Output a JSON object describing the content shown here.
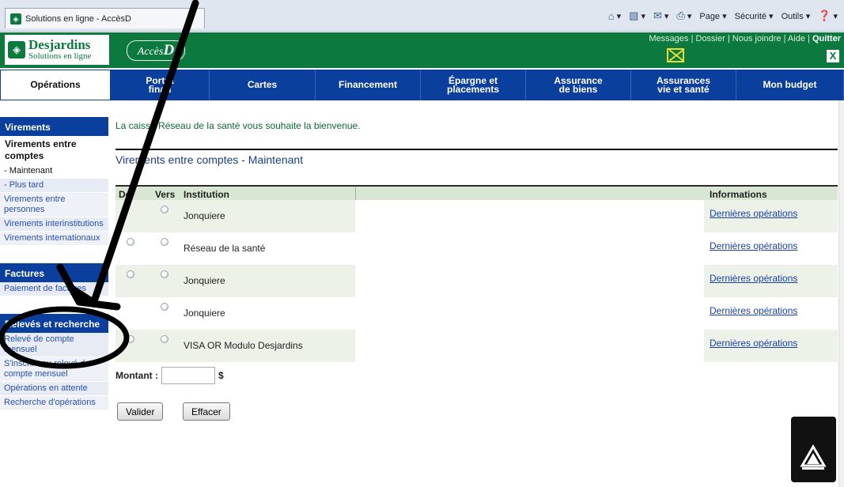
{
  "browser": {
    "tab_title": "Solutions en ligne - AccèsD",
    "commands": [
      "Page ▾",
      "Sécurité ▾",
      "Outils ▾"
    ]
  },
  "header": {
    "logo_line1": "Desjardins",
    "logo_line2": "Solutions en ligne",
    "accesd": "Accès",
    "accesd_d": "D",
    "links": [
      "Messages",
      "Dossier",
      "Nous joindre",
      "Aide",
      "Quitter"
    ]
  },
  "nav": {
    "items": [
      {
        "label": "Opérations",
        "active": true
      },
      {
        "label": "Portrait financier",
        "display": "Portra|finan"
      },
      {
        "label": "Cartes"
      },
      {
        "label": "Financement"
      },
      {
        "label": "Épargne et placements"
      },
      {
        "label": "Assurance de biens"
      },
      {
        "label": "Assurances vie et santé"
      },
      {
        "label": "Mon budget"
      }
    ]
  },
  "sidebar": {
    "virements_head": "Virements",
    "virements_sub": "Virements entre comptes",
    "maintenant": "- Maintenant",
    "plus_tard": "- Plus tard",
    "entre_personnes": "Virements entre personnes",
    "interinstitutions": "Virements interinstitutions",
    "internationaux": "Virements internationaux",
    "factures_head": "Factures",
    "paiement": "Paiement de factures",
    "releves_head": "Relevés et recherche",
    "releve_mensuel": "Relevé de compte mensuel",
    "inscrire": "S'inscrire au relevé de compte mensuel",
    "en_attente": "Opérations en attente",
    "recherche": "Recherche d'opérations"
  },
  "main": {
    "welcome": "La caisse Réseau de la santé vous souhaite la bienvenue.",
    "section_title": "Virements entre comptes - Maintenant",
    "columns": {
      "de": "De",
      "vers": "Vers",
      "institution": "Institution",
      "informations": "Informations"
    },
    "rows": [
      {
        "institution": "Jonquiere",
        "info": "Dernières opérations"
      },
      {
        "institution": "Réseau de la santé",
        "info": "Dernières opérations"
      },
      {
        "institution": "Jonquiere",
        "info": "Dernières opérations"
      },
      {
        "institution": "Jonquiere",
        "info": "Dernières opérations"
      },
      {
        "institution": "VISA OR Modulo Desjardins",
        "info": "Dernières opérations"
      }
    ],
    "montant_label": "Montant :",
    "montant_value": "",
    "currency": "$",
    "valider": "Valider",
    "effacer": "Effacer"
  },
  "annotation": {
    "arrow_color": "#000000",
    "ellipse_target": "Factures / Paiement de factures"
  }
}
